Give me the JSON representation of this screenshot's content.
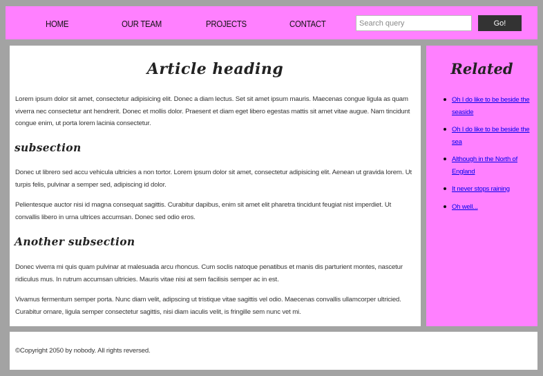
{
  "nav": {
    "items": [
      {
        "label": "HOME"
      },
      {
        "label": "OUR TEAM"
      },
      {
        "label": "PROJECTS"
      },
      {
        "label": "CONTACT"
      }
    ],
    "search_placeholder": "Search query",
    "go_label": "Go!"
  },
  "article": {
    "heading": "Article heading",
    "intro": "Lorem ipsum dolor sit amet, consectetur adipisicing elit. Donec a diam lectus. Set sit amet ipsum mauris. Maecenas congue ligula as quam viverra nec consectetur ant hendrerit. Donec et mollis dolor. Praesent et diam eget libero egestas mattis sit amet vitae augue. Nam tincidunt congue enim, ut porta lorem lacinia consectetur.",
    "subsection1": {
      "heading": "subsection",
      "p1": "Donec ut librero sed accu vehicula ultricies a non tortor. Lorem ipsum dolor sit amet, consectetur adipisicing elit. Aenean ut gravida lorem. Ut turpis felis, pulvinar a semper sed, adipiscing id dolor.",
      "p2": "Pelientesque auctor nisi id magna consequat sagittis. Curabitur dapibus, enim sit amet elit pharetra tincidunt feugiat nist imperdiet. Ut convallis libero in urna ultrices accumsan. Donec sed odio eros."
    },
    "subsection2": {
      "heading": "Another subsection",
      "p1": "Donec viverra mi quis quam pulvinar at malesuada arcu rhoncus. Cum soclis natoque penatibus et manis dis parturient montes, nascetur ridiculus mus. In rutrum accumsan ultricies. Mauris vitae nisi at sem facilisis semper ac in est.",
      "p2": "Vivamus fermentum semper porta. Nunc diam velit, adipscing ut tristique vitae sagittis vel odio. Maecenas convallis ullamcorper ultricied. Curabitur ornare, ligula semper consectetur sagittis, nisi diam iaculis velit, is fringille sem nunc vet mi."
    }
  },
  "sidebar": {
    "heading": "Related",
    "links": [
      {
        "label": "Oh I do like to be beside the seaside"
      },
      {
        "label": "Oh I do like to be beside the sea"
      },
      {
        "label": "Although in the North of England"
      },
      {
        "label": "It never stops raining"
      },
      {
        "label": "Oh well..."
      }
    ]
  },
  "footer": {
    "copyright": "©Copyright 2050 by nobody. All rights reversed."
  }
}
